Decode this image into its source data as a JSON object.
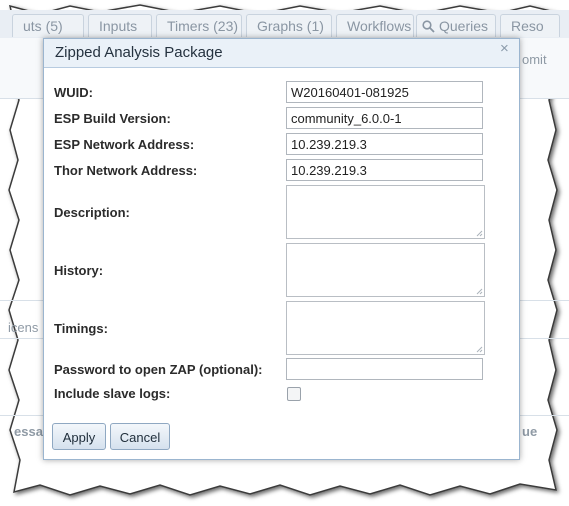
{
  "background": {
    "tabs": [
      "uts (5)",
      "Inputs",
      "Timers (23)",
      "Graphs (1)",
      "Workflows",
      "Queries",
      "Reso"
    ],
    "fragments": [
      "omit",
      "icens",
      "essa",
      "ue"
    ]
  },
  "dialog": {
    "title": "Zipped Analysis Package",
    "close": "×",
    "fields": {
      "wuid": {
        "label": "WUID:",
        "value": "W20160401-081925"
      },
      "esp_build": {
        "label": "ESP Build Version:",
        "value": "community_6.0.0-1"
      },
      "esp_network": {
        "label": "ESP Network Address:",
        "value": "10.239.219.3"
      },
      "thor_network": {
        "label": "Thor Network Address:",
        "value": "10.239.219.3"
      },
      "description": {
        "label": "Description:",
        "value": ""
      },
      "history": {
        "label": "History:",
        "value": ""
      },
      "timings": {
        "label": "Timings:",
        "value": ""
      },
      "password": {
        "label": "Password to open ZAP (optional):",
        "value": ""
      },
      "slave_logs": {
        "label": "Include slave logs:",
        "checked": false
      }
    },
    "buttons": {
      "apply": "Apply",
      "cancel": "Cancel"
    }
  },
  "icons": {
    "queries_tab": "search-icon",
    "close": "close-icon"
  }
}
